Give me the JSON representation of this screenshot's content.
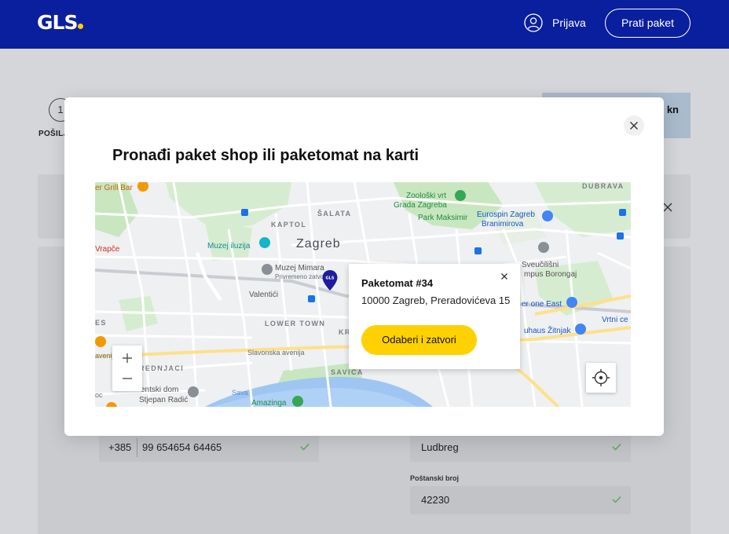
{
  "header": {
    "logo": "GLS",
    "login_label": "Prijava",
    "track_label": "Prati paket"
  },
  "background": {
    "step_number": "1",
    "step_label": "POŠILJ",
    "summary_suffix": "kn",
    "phone_prefix": "+385",
    "phone_value": "99 654654 64465",
    "city_value": "Ludbreg",
    "postal_label": "Poštanski broj",
    "postal_value": "42230"
  },
  "modal": {
    "title": "Pronađi paket shop ili paketomat na karti",
    "popup": {
      "title": "Paketomat #34",
      "address": "10000 Zagreb, Preradovićeva 15",
      "button_label": "Odaberi i zatvori"
    }
  },
  "map": {
    "labels": {
      "zagreb": "Zagreb",
      "kaptol": "KAPTOL",
      "salata": "ŠALATA",
      "dubrava": "DUBRAVA",
      "lower_town": "LOWER TOWN",
      "savica": "SAVICA",
      "trnje": "REDNJACI",
      "valentici": "Valentići",
      "zoo": "Zoološki vrt Grada Zagreba",
      "zoo_line1": "Zoološki vrt",
      "zoo_line2": "Grada Zagreba",
      "park": "Park Maksimir",
      "eurospin_line1": "Eurospin Zagreb",
      "eurospin_line2": "Branimirova",
      "museum_illusions": "Muzej iluzija",
      "museum_mimara": "Muzej Mimara",
      "museum_mimara_sub": "Privremeno zatvoreno",
      "campus_line1": "Sveučilišni",
      "campus_line2": "mpus Borongaj",
      "one_east": "er one East",
      "vrtni": "Vrtni ce",
      "bauhaus": "uhaus Žitnjak",
      "grill": "er Grill Bar",
      "vrapce": "Vrapče",
      "studentski_line1": "entski dom",
      "studentski_line2": "Stjepan Radić",
      "amazinga": "Amazinga",
      "slavonska": "Slavonska avenija",
      "slavonska_left": "avenija",
      "sava": "Sava",
      "es": "ES",
      "kr": "KR",
      "oc": "oc"
    },
    "colors": {
      "park": "#c8e6c0",
      "road_major": "#ffe08a",
      "road_minor": "#ffffff",
      "water": "#9fc6f2",
      "pin": "#1d1d9e"
    },
    "zoom_in": "+",
    "zoom_out": "−"
  }
}
